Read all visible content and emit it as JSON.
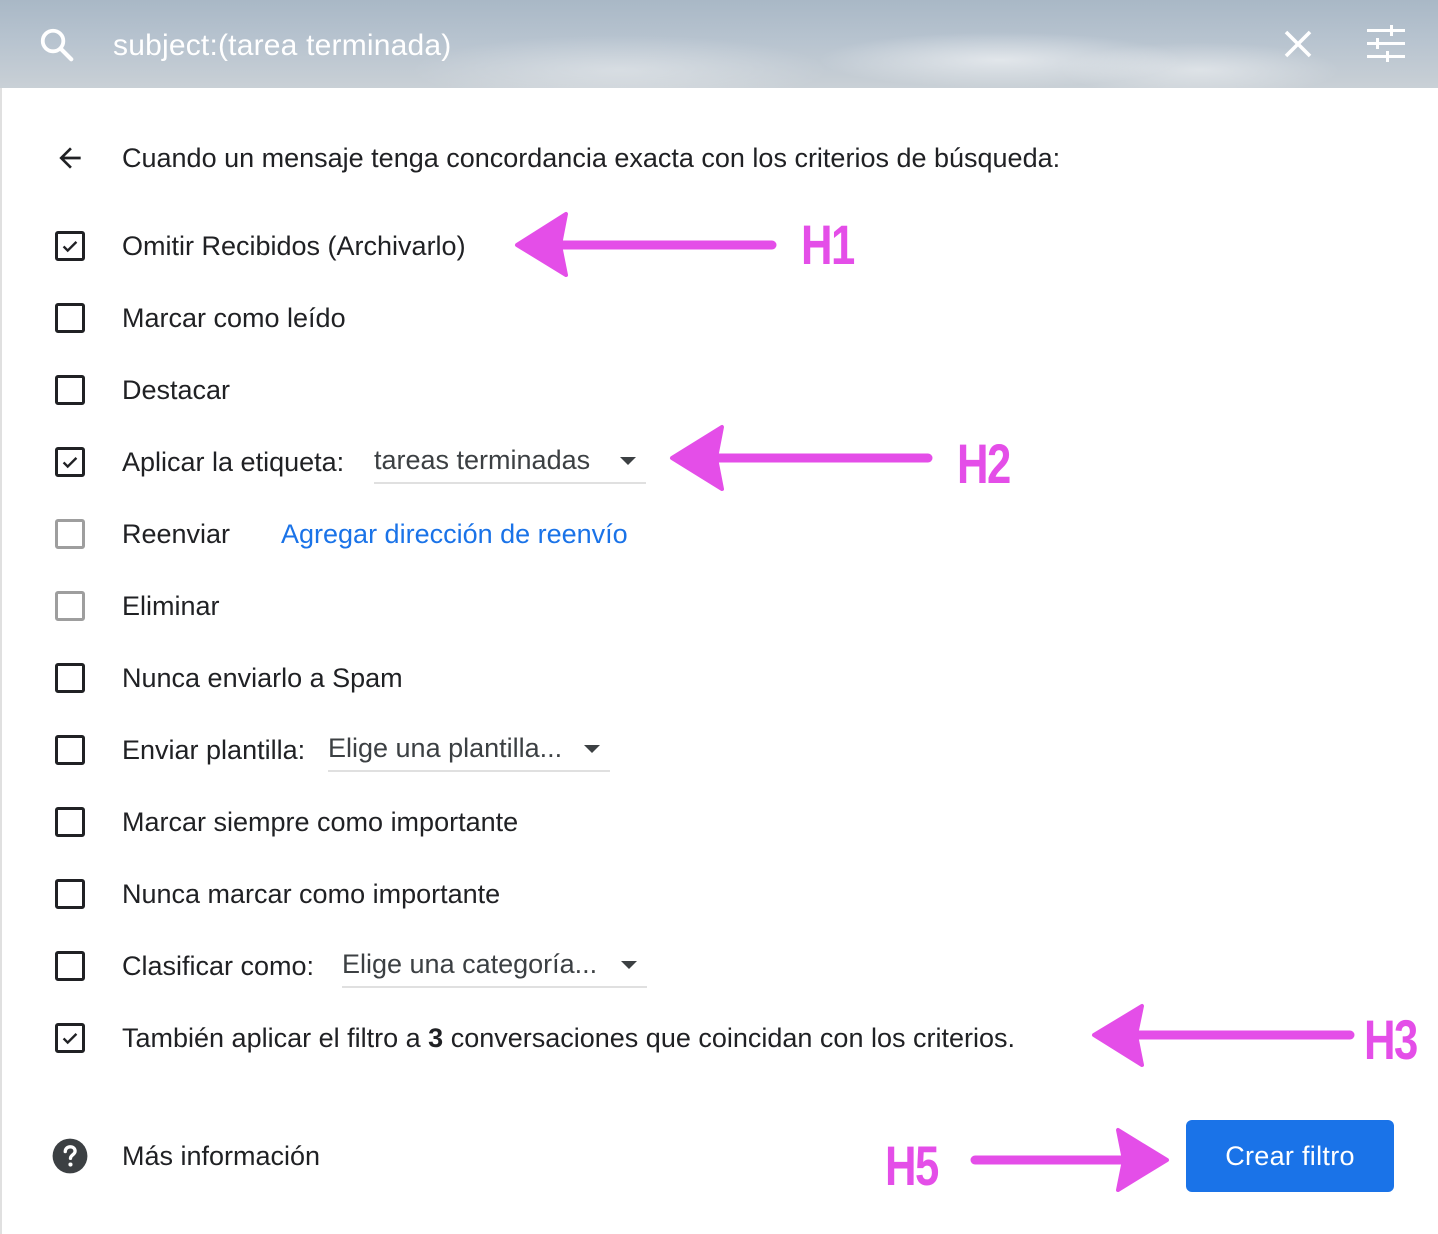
{
  "search": {
    "query": "subject:(tarea terminada)",
    "icons": {
      "search": "search-icon",
      "close": "close-icon",
      "options": "tune-icon"
    }
  },
  "panel": {
    "heading": "Cuando un mensaje tenga concordancia exacta con los criterios de búsqueda:",
    "options": [
      {
        "label": "Omitir Recibidos (Archivarlo)",
        "checked": true
      },
      {
        "label": "Marcar como leído",
        "checked": false
      },
      {
        "label": "Destacar",
        "checked": false
      },
      {
        "label": "Aplicar la etiqueta:",
        "checked": true,
        "select_value": "tareas terminadas"
      },
      {
        "label": "Reenviar",
        "checked": false,
        "disabled": true,
        "link": "Agregar dirección de reenvío"
      },
      {
        "label": "Eliminar",
        "checked": false,
        "disabled": true
      },
      {
        "label": "Nunca enviarlo a Spam",
        "checked": false
      },
      {
        "label": "Enviar plantilla:",
        "checked": false,
        "select_value": "Elige una plantilla..."
      },
      {
        "label": "Marcar siempre como importante",
        "checked": false
      },
      {
        "label": "Nunca marcar como importante",
        "checked": false
      },
      {
        "label": "Clasificar como:",
        "checked": false,
        "select_value": "Elige una categoría..."
      },
      {
        "label_before": "También aplicar el filtro a",
        "label_count": "3",
        "label_after": "conversaciones que coincidan con los criterios.",
        "checked": true
      }
    ],
    "help": "Más información",
    "create_button": "Crear filtro"
  },
  "annotations": {
    "color": "#e44ee8",
    "labels": [
      "H1",
      "H2",
      "H3",
      "H5"
    ]
  },
  "colors": {
    "accent": "#1a73e8",
    "text": "#202124",
    "disabled": "#9e9e9e"
  }
}
